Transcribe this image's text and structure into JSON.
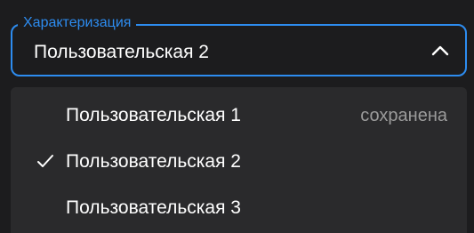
{
  "field": {
    "label": "Характеризация",
    "value": "Пользовательская 2",
    "expanded_icon": "chevron-up-icon",
    "accent_color": "#2d8cf0"
  },
  "menu": {
    "items": [
      {
        "label": "Пользовательская 1",
        "status": "сохранена",
        "selected": false
      },
      {
        "label": "Пользовательская 2",
        "status": "",
        "selected": true
      },
      {
        "label": "Пользовательская 3",
        "status": "",
        "selected": false
      }
    ],
    "check_icon": "checkmark-icon"
  }
}
